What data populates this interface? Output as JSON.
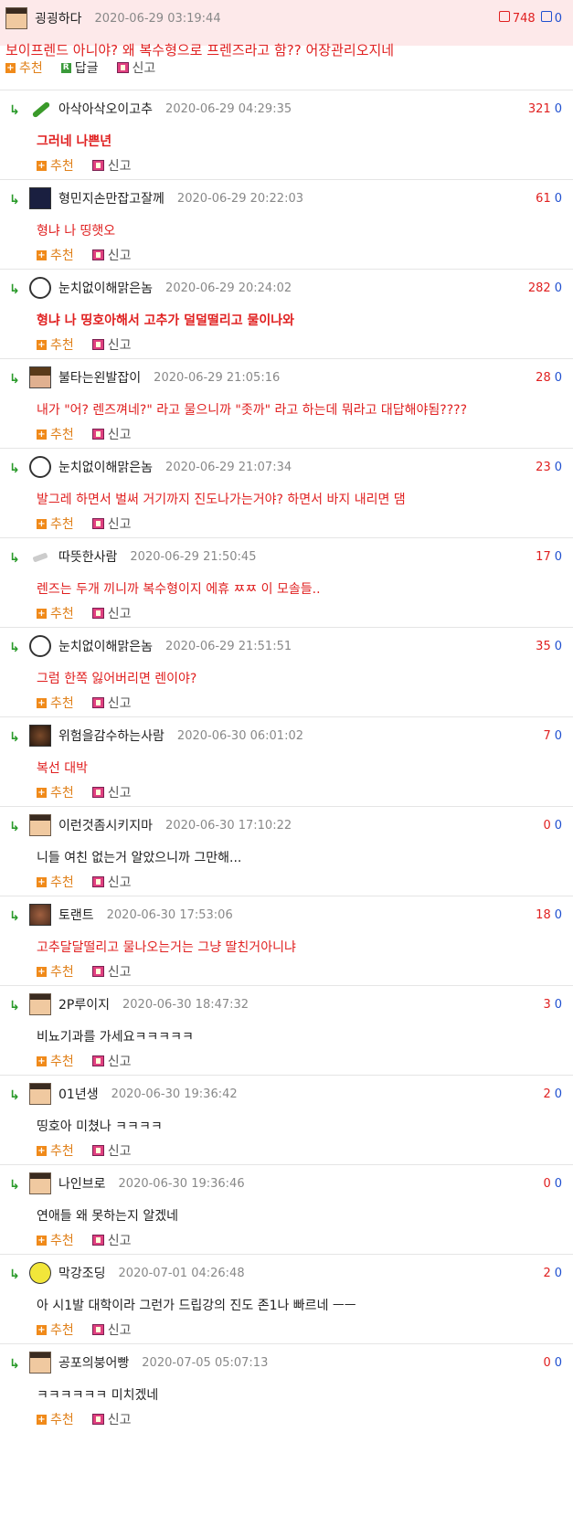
{
  "main_post": {
    "author": "굉굉하다",
    "date": "2020-06-29 03:19:44",
    "up": "748",
    "down": "0",
    "body": "보이프렌드 아니야? 왜 복수형으로 프렌즈라고 함?? 어장관리오지네",
    "recommend": "추천",
    "reply": "답글",
    "report": "신고"
  },
  "actions": {
    "recommend": "추천",
    "report": "신고"
  },
  "comments": [
    {
      "author": "아삭아삭오이고추",
      "date": "2020-06-29 04:29:35",
      "up": "321",
      "down": "0",
      "body": "그러네 나쁜년",
      "avatar": "leaf-icon"
    },
    {
      "author": "형민지손만잡고잘께",
      "date": "2020-06-29 20:22:03",
      "up": "61",
      "down": "0",
      "body": "형냐 나 띵햇오",
      "avatar": "dark-avatar"
    },
    {
      "author": "눈치없이해맑은놈",
      "date": "2020-06-29 20:24:02",
      "up": "282",
      "down": "0",
      "body": "형냐 나 띵호아해서 고추가 덜덜떨리고 물이나와",
      "avatar": "face-avatar"
    },
    {
      "author": "불타는왼발잡이",
      "date": "2020-06-29 21:05:16",
      "up": "28",
      "down": "0",
      "body": "내가 \"어? 렌즈껴네?\" 라고 물으니까 \"좃까\" 라고 하는데 뭐라고 대답해야됨????",
      "avatar": "hair-avatar"
    },
    {
      "author": "눈치없이해맑은놈",
      "date": "2020-06-29 21:07:34",
      "up": "23",
      "down": "0",
      "body": "발그레 하면서 벌써 거기까지 진도나가는거야? 하면서 바지 내리면 댐",
      "avatar": "face-avatar"
    },
    {
      "author": "따뜻한사람",
      "date": "2020-06-29 21:50:45",
      "up": "17",
      "down": "0",
      "body": "렌즈는 두개 끼니까 복수형이지 에휴 ㅉㅉ 이 모솔들..",
      "avatar": "small-avatar"
    },
    {
      "author": "눈치없이해맑은놈",
      "date": "2020-06-29 21:51:51",
      "up": "35",
      "down": "0",
      "body": "그럼 한쪽 잃어버리면 렌이야?",
      "avatar": "face-avatar"
    },
    {
      "author": "위험을감수하는사람",
      "date": "2020-06-30 06:01:02",
      "up": "7",
      "down": "0",
      "body": "복선 대박",
      "avatar": "dark2-avatar"
    },
    {
      "author": "이런것좀시키지마",
      "date": "2020-06-30 17:10:22",
      "up": "0",
      "down": "0",
      "body": "니들 여친 없는거 알았으니까 그만해...",
      "avatar": "pixel-avatar"
    },
    {
      "author": "토랜트",
      "date": "2020-06-30 17:53:06",
      "up": "18",
      "down": "0",
      "body": "고추달달떨리고 물나오는거는 그냥 딸친거아니냐",
      "avatar": "brown-avatar"
    },
    {
      "author": "2P루이지",
      "date": "2020-06-30 18:47:32",
      "up": "3",
      "down": "0",
      "body": "비뇨기과를 가세요ㅋㅋㅋㅋㅋ",
      "avatar": "pixel-avatar"
    },
    {
      "author": "01년생",
      "date": "2020-06-30 19:36:42",
      "up": "2",
      "down": "0",
      "body": "띵호아 미쳤나 ㅋㅋㅋㅋ",
      "avatar": "pixel-avatar"
    },
    {
      "author": "나인브로",
      "date": "2020-06-30 19:36:46",
      "up": "0",
      "down": "0",
      "body": "연애들 왜 못하는지 알겠네",
      "avatar": "pixel-avatar"
    },
    {
      "author": "막강조딩",
      "date": "2020-07-01 04:26:48",
      "up": "2",
      "down": "0",
      "body": "아 시1발 대학이라 그런가 드립강의 진도 존1나 빠르네 ㅡㅡ",
      "avatar": "yellow-avatar"
    },
    {
      "author": "공포의붕어빵",
      "date": "2020-07-05 05:07:13",
      "up": "0",
      "down": "0",
      "body": "ㅋㅋㅋㅋㅋㅋ 미치겠네",
      "avatar": "pixel-avatar"
    }
  ]
}
